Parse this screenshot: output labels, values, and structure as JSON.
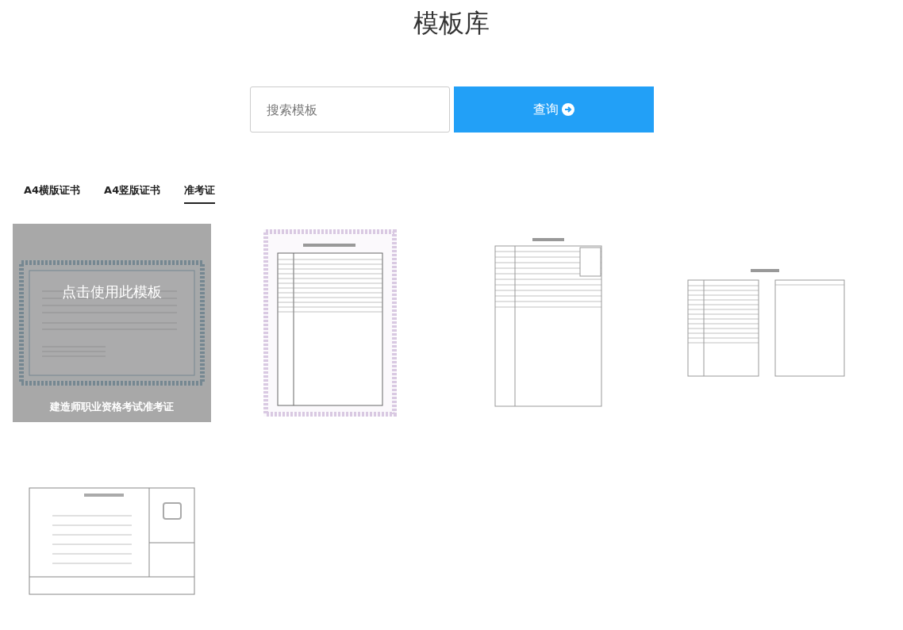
{
  "title": "模板库",
  "search": {
    "placeholder": "搜索模板",
    "button": "查询"
  },
  "tabs": [
    {
      "label": "A4横版证书",
      "selected": false
    },
    {
      "label": "A4竖版证书",
      "selected": false
    },
    {
      "label": "准考证",
      "selected": true
    }
  ],
  "templates": [
    {
      "kind": "landscape-certificate",
      "hovered": true,
      "action": "点击使用此模板",
      "name": "建造师职业资格考试准考证"
    },
    {
      "kind": "portrait-certificate",
      "hovered": false
    },
    {
      "kind": "portrait-form",
      "hovered": false
    },
    {
      "kind": "double-form",
      "hovered": false
    },
    {
      "kind": "card-form",
      "hovered": false
    }
  ]
}
